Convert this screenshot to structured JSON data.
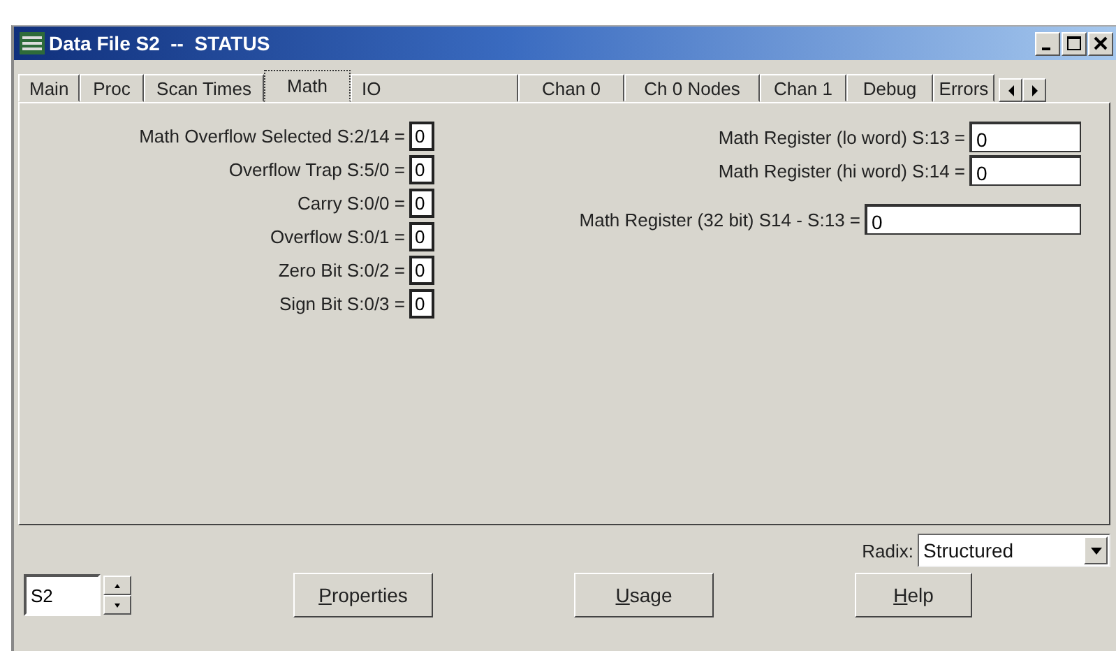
{
  "window": {
    "title": "Data File S2  --  STATUS"
  },
  "tabs": [
    {
      "label": "Main",
      "selected": false
    },
    {
      "label": "Proc",
      "selected": false
    },
    {
      "label": "Scan Times",
      "selected": false
    },
    {
      "label": "Math",
      "selected": true
    },
    {
      "label": "IO",
      "selected": false
    },
    {
      "label": "Chan 0",
      "selected": false
    },
    {
      "label": "Ch 0 Nodes",
      "selected": false
    },
    {
      "label": "Chan 1",
      "selected": false
    },
    {
      "label": "Debug",
      "selected": false
    },
    {
      "label": "Errors",
      "selected": false
    }
  ],
  "left_fields": [
    {
      "label": "Math Overflow Selected S:2/14 =",
      "value": "0"
    },
    {
      "label": "Overflow Trap S:5/0 =",
      "value": "0"
    },
    {
      "label": "Carry S:0/0 =",
      "value": "0"
    },
    {
      "label": "Overflow S:0/1 =",
      "value": "0"
    },
    {
      "label": "Zero Bit S:0/2 =",
      "value": "0"
    },
    {
      "label": "Sign Bit S:0/3 =",
      "value": "0"
    }
  ],
  "right_fields": [
    {
      "label": "Math Register (lo word) S:13 =",
      "value": "0",
      "kind": "short"
    },
    {
      "label": "Math Register (hi word) S:14 =",
      "value": "0",
      "kind": "short"
    },
    {
      "label": "Math Register (32 bit) S14 - S:13 =",
      "value": "0",
      "kind": "long"
    }
  ],
  "radix": {
    "label": "Radix:",
    "value": "Structured"
  },
  "file_field": {
    "value": "S2"
  },
  "buttons": [
    "Properties",
    "Usage",
    "Help"
  ]
}
